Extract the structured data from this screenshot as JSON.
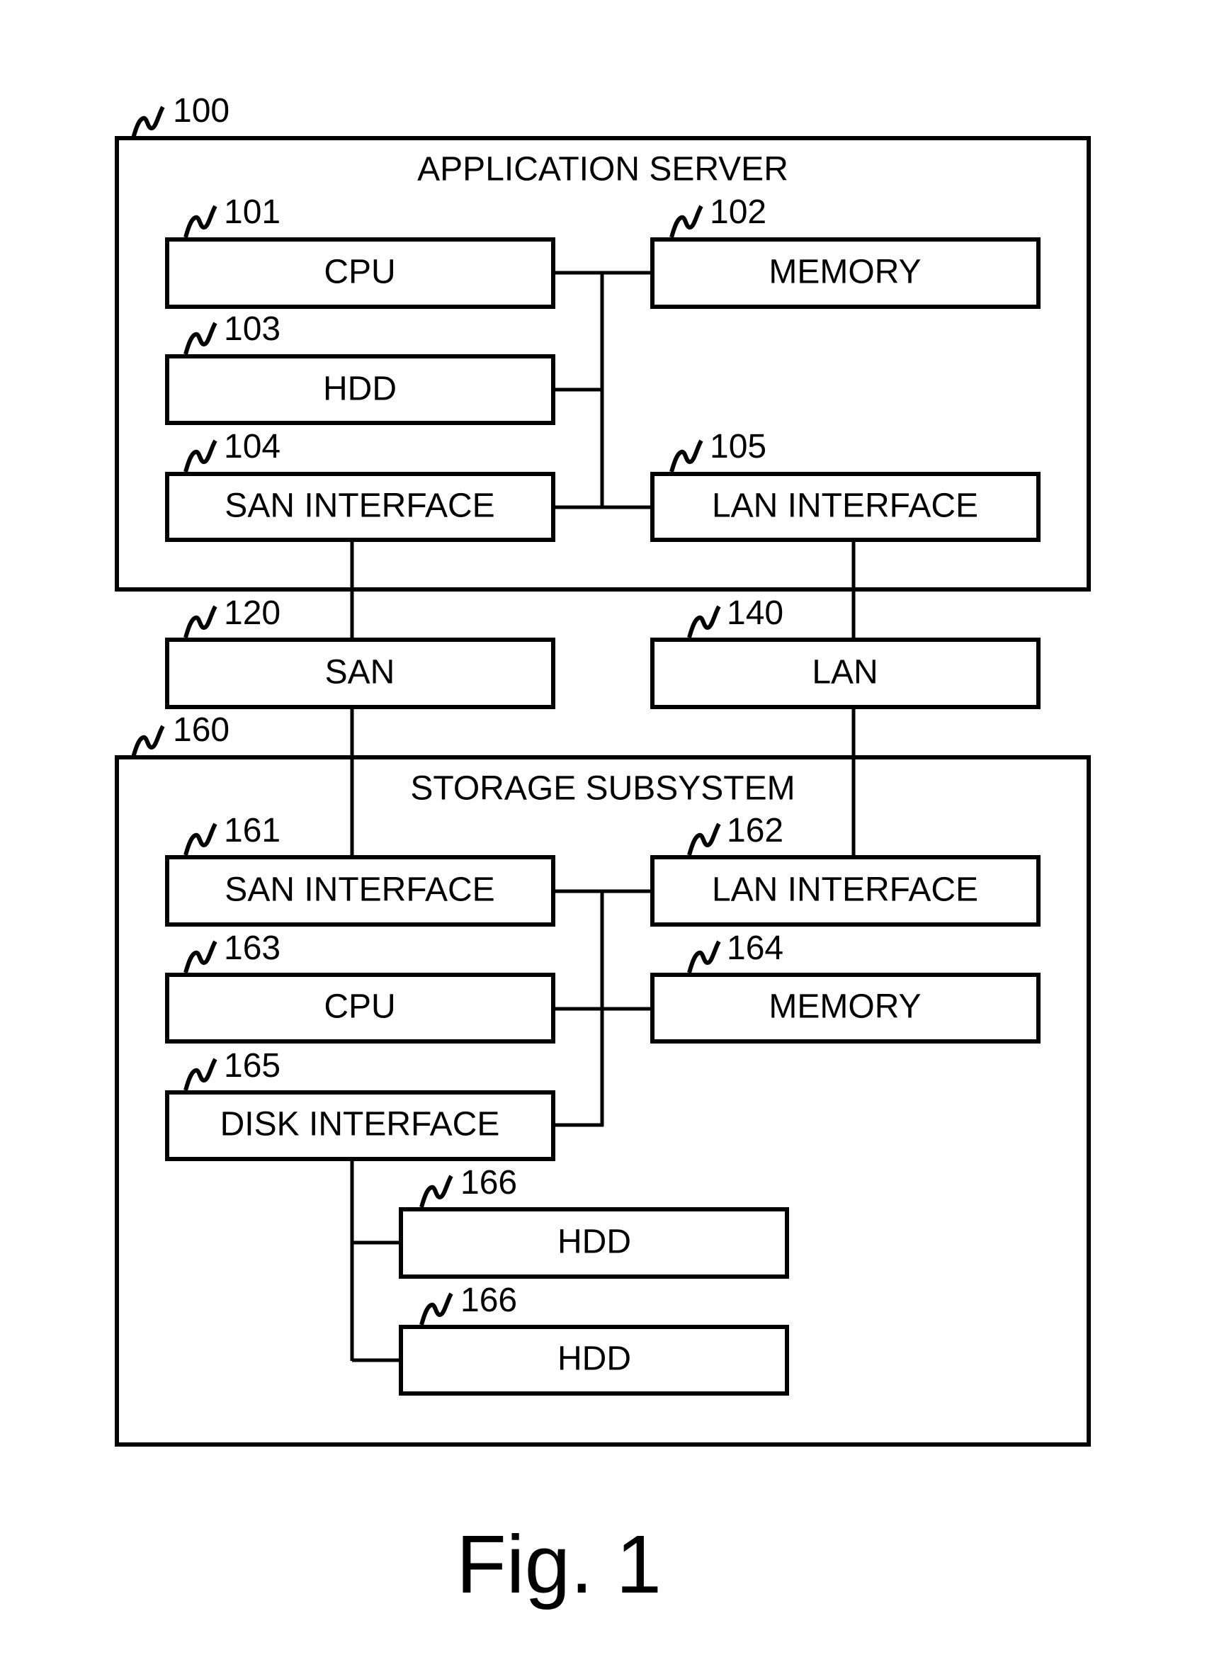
{
  "figure_caption": "Fig. 1",
  "application_server": {
    "ref": "100",
    "title": "APPLICATION SERVER",
    "components": [
      {
        "ref": "101",
        "label": "CPU"
      },
      {
        "ref": "102",
        "label": "MEMORY"
      },
      {
        "ref": "103",
        "label": "HDD"
      },
      {
        "ref": "104",
        "label": "SAN INTERFACE"
      },
      {
        "ref": "105",
        "label": "LAN INTERFACE"
      }
    ]
  },
  "networks": [
    {
      "ref": "120",
      "label": "SAN"
    },
    {
      "ref": "140",
      "label": "LAN"
    }
  ],
  "storage_subsystem": {
    "ref": "160",
    "title": "STORAGE SUBSYSTEM",
    "components": [
      {
        "ref": "161",
        "label": "SAN INTERFACE"
      },
      {
        "ref": "162",
        "label": "LAN INTERFACE"
      },
      {
        "ref": "163",
        "label": "CPU"
      },
      {
        "ref": "164",
        "label": "MEMORY"
      },
      {
        "ref": "165",
        "label": "DISK INTERFACE"
      },
      {
        "ref": "166",
        "label": "HDD"
      },
      {
        "ref": "166",
        "label": "HDD"
      }
    ]
  }
}
